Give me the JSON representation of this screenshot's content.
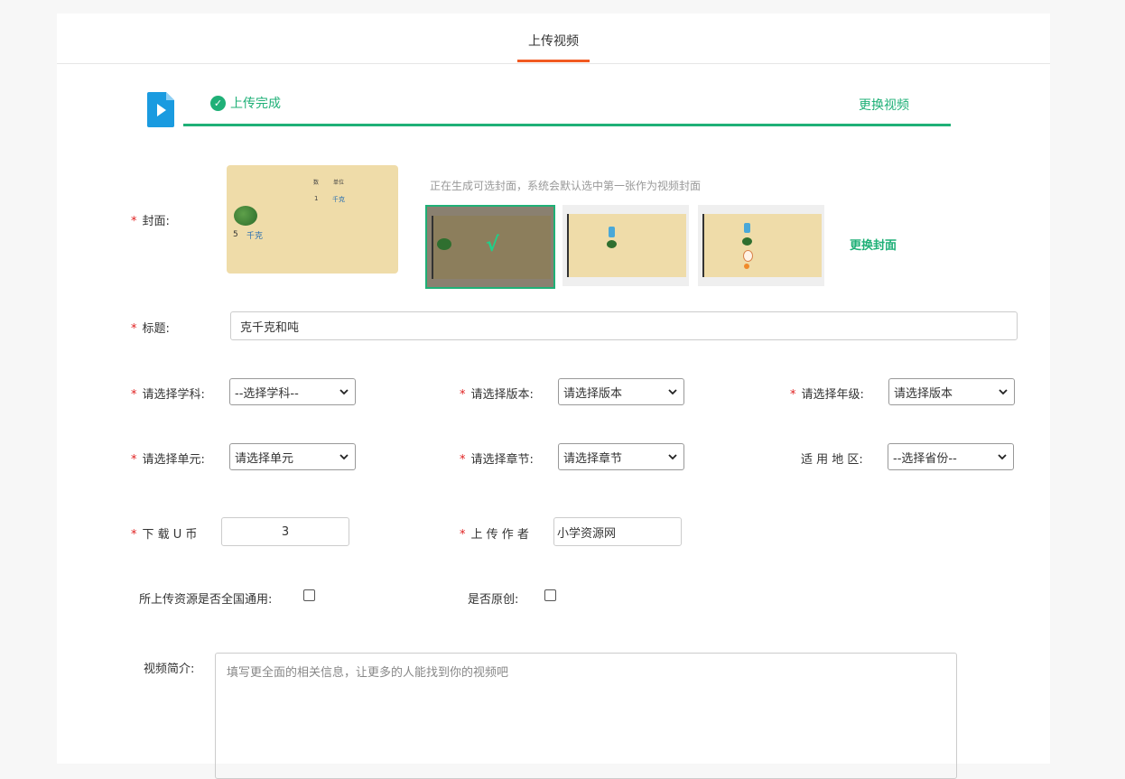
{
  "tabs": {
    "active_label": "上传视频"
  },
  "upload": {
    "status_text": "上传完成",
    "replace_video_label": "更换视频"
  },
  "cover": {
    "label": "封面:",
    "hint": "正在生成可选封面，系统会默认选中第一张作为视频封面",
    "replace_label": "更换封面",
    "preview_text": {
      "col1": "数",
      "col2": "单位",
      "row1_num": "1",
      "row1_unit": "千克",
      "row2_num": "5",
      "row2_unit": "千克"
    },
    "selected_mark": "√"
  },
  "title_field": {
    "label": "标题:",
    "value": "克千克和吨"
  },
  "subject": {
    "label": "请选择学科:",
    "selected": "--选择学科--"
  },
  "edition": {
    "label": "请选择版本:",
    "selected": "请选择版本"
  },
  "grade": {
    "label": "请选择年级:",
    "selected": "请选择版本"
  },
  "unit": {
    "label": "请选择单元:",
    "selected": "请选择单元"
  },
  "chapter": {
    "label": "请选择章节:",
    "selected": "请选择章节"
  },
  "region": {
    "label": "适 用 地 区:",
    "selected": "--选择省份--"
  },
  "download_coin": {
    "label": "下 载 U 币",
    "value": "3"
  },
  "author": {
    "label": "上 传 作 者",
    "value": "小学资源网"
  },
  "national": {
    "label": "所上传资源是否全国通用:"
  },
  "original": {
    "label": "是否原创:"
  },
  "description": {
    "label": "视频简介:",
    "placeholder": "填写更全面的相关信息，让更多的人能找到你的视频吧"
  },
  "colors": {
    "accent_green": "#1fb077",
    "tab_underline": "#f15a22",
    "required": "#e02020"
  }
}
